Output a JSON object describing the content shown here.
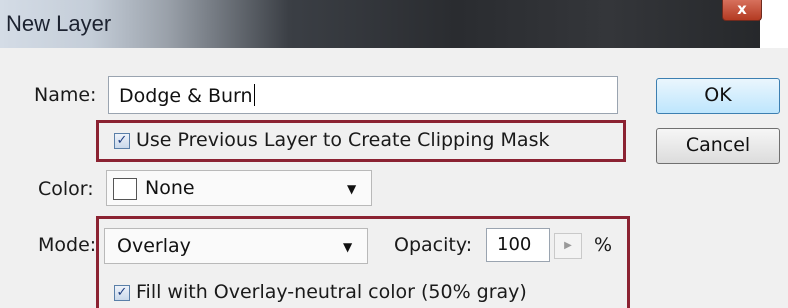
{
  "window": {
    "title": "New Layer",
    "close_glyph": "x"
  },
  "name_field": {
    "label": "Name:",
    "value": "Dodge & Burn"
  },
  "clipping_mask": {
    "label": "Use Previous Layer to Create Clipping Mask",
    "checked": true
  },
  "color_field": {
    "label": "Color:",
    "value": "None",
    "swatch_color": "#ffffff"
  },
  "mode_field": {
    "label": "Mode:",
    "value": "Overlay"
  },
  "opacity_field": {
    "label": "Opacity:",
    "value": "100",
    "unit": "%"
  },
  "fill_neutral": {
    "label": "Fill with Overlay-neutral color (50% gray)",
    "checked": true
  },
  "buttons": {
    "ok": "OK",
    "cancel": "Cancel"
  },
  "colors": {
    "highlight_border": "#8b2232",
    "default_button": "#bee6fd"
  }
}
